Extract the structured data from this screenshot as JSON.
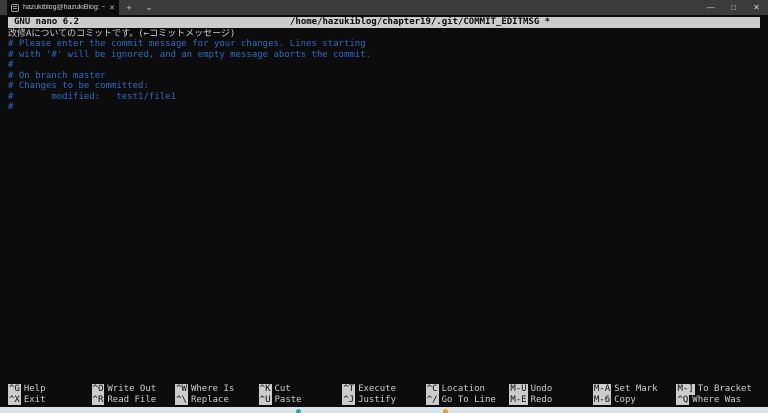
{
  "window": {
    "tab": {
      "title": "hazukiblog@hazukiBlog: ~/ch",
      "close_glyph": "✕"
    },
    "new_tab_glyph": "+",
    "tab_dropdown_glyph": "⌄",
    "controls": {
      "minimize": "—",
      "maximize": "□",
      "close": "✕"
    }
  },
  "nano": {
    "titlebar": {
      "app": "GNU nano 6.2",
      "file": "/home/hazukiblog/chapter19/.git/COMMIT_EDITMSG *"
    },
    "lines": [
      {
        "text": "改修Aについてのコミットです。(←コミットメッセージ)",
        "color": "white"
      },
      {
        "text": "# Please enter the commit message for your changes. Lines starting",
        "color": "blue"
      },
      {
        "text": "# with '#' will be ignored, and an empty message aborts the commit.",
        "color": "blue"
      },
      {
        "text": "#",
        "color": "blue"
      },
      {
        "text": "# On branch master",
        "color": "blue"
      },
      {
        "text": "# Changes to be committed:",
        "color": "blue"
      },
      {
        "text": "#       modified:   test1/file1",
        "color": "blue"
      },
      {
        "text": "#",
        "color": "blue"
      }
    ],
    "shortcuts": [
      {
        "top": {
          "key": "^G",
          "label": "Help"
        },
        "bottom": {
          "key": "^X",
          "label": "Exit"
        }
      },
      {
        "top": {
          "key": "^O",
          "label": "Write Out"
        },
        "bottom": {
          "key": "^R",
          "label": "Read File"
        }
      },
      {
        "top": {
          "key": "^W",
          "label": "Where Is"
        },
        "bottom": {
          "key": "^\\",
          "label": "Replace"
        }
      },
      {
        "top": {
          "key": "^K",
          "label": "Cut"
        },
        "bottom": {
          "key": "^U",
          "label": "Paste"
        }
      },
      {
        "top": {
          "key": "^T",
          "label": "Execute"
        },
        "bottom": {
          "key": "^J",
          "label": "Justify"
        }
      },
      {
        "top": {
          "key": "^C",
          "label": "Location"
        },
        "bottom": {
          "key": "^/",
          "label": "Go To Line"
        }
      },
      {
        "top": {
          "key": "M-U",
          "label": "Undo"
        },
        "bottom": {
          "key": "M-E",
          "label": "Redo"
        }
      },
      {
        "top": {
          "key": "M-A",
          "label": "Set Mark"
        },
        "bottom": {
          "key": "M-6",
          "label": "Copy"
        }
      },
      {
        "top": {
          "key": "M-]",
          "label": "To Bracket"
        },
        "bottom": {
          "key": "^Q",
          "label": "Where Was"
        }
      }
    ]
  },
  "colors": {
    "terminal_bg": "#0c0c0c",
    "terminal_fg": "#cccccc",
    "comment_blue": "#2a6cc4",
    "reverse_video_bg": "#cccccc",
    "titlebar_bg": "#3b3b3b",
    "taskbar_bg": "#d9e5ea"
  }
}
